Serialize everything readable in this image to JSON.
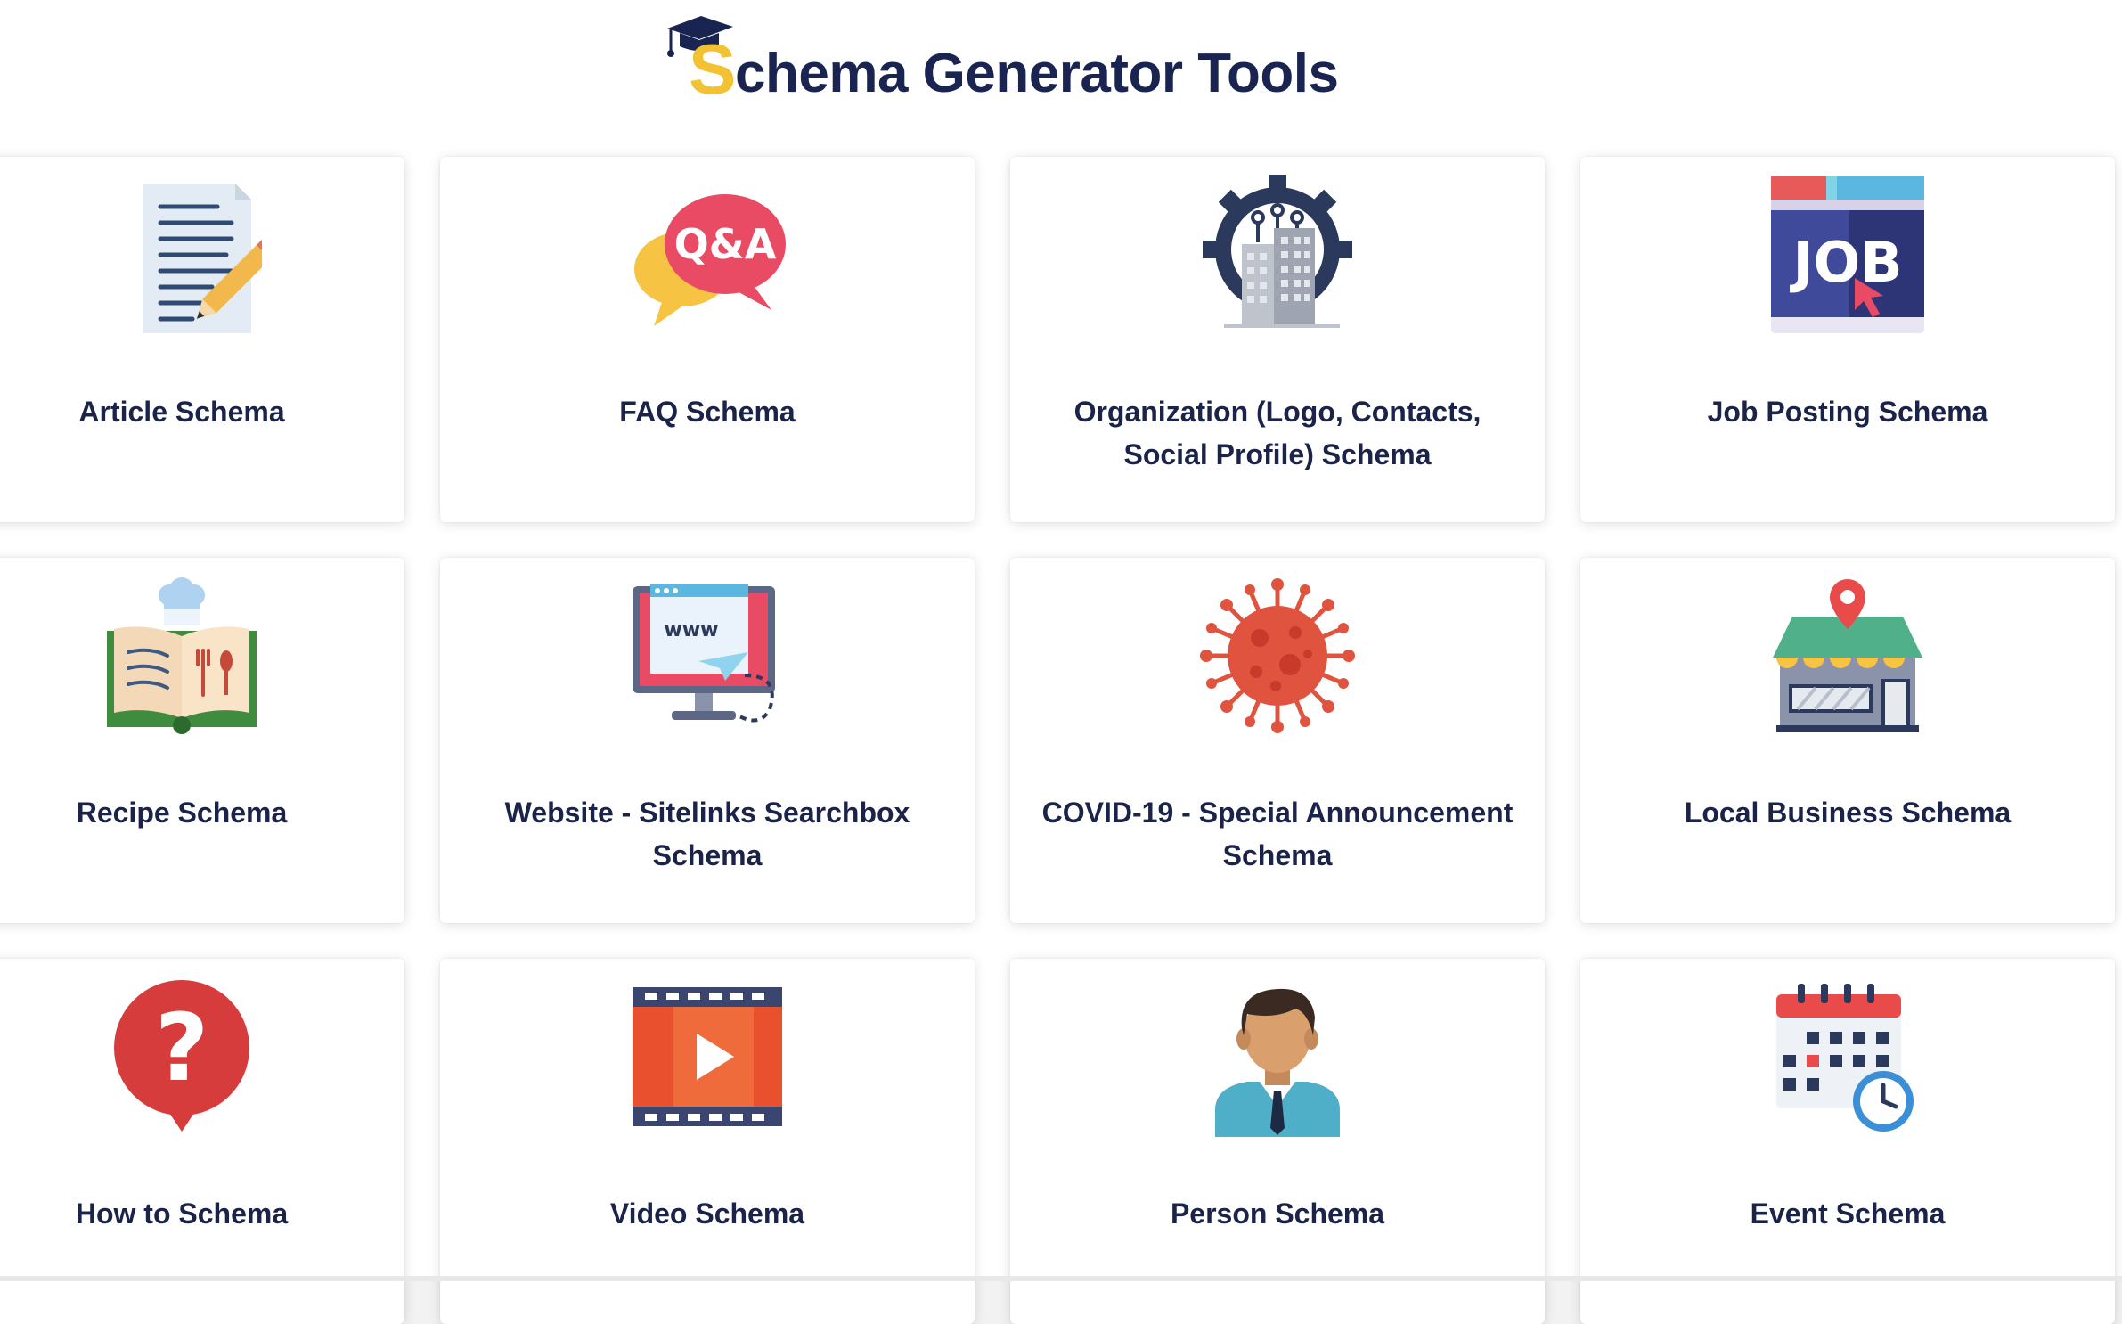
{
  "header": {
    "logo_letter": "S",
    "logo_rest": "chema Generator Tools"
  },
  "colors": {
    "brand_navy": "#1a2451",
    "brand_yellow": "#f2c232",
    "label": "#1b2348"
  },
  "cards": [
    {
      "label": "Article Schema",
      "icon": "article-document-pencil-icon"
    },
    {
      "label": "FAQ Schema",
      "icon": "qa-speech-bubbles-icon"
    },
    {
      "label": "Organization (Logo, Contacts, Social Profile) Schema",
      "icon": "organization-gear-building-icon"
    },
    {
      "label": "Job Posting Schema",
      "icon": "job-browser-icon"
    },
    {
      "label": "Recipe Schema",
      "icon": "recipe-book-chef-hat-icon"
    },
    {
      "label": "Website - Sitelinks Searchbox Schema",
      "icon": "website-monitor-www-icon"
    },
    {
      "label": "COVID-19 - Special Announcement Schema",
      "icon": "virus-icon"
    },
    {
      "label": "Local Business Schema",
      "icon": "storefront-location-pin-icon"
    },
    {
      "label": "How to Schema",
      "icon": "question-mark-bubble-icon"
    },
    {
      "label": "Video Schema",
      "icon": "video-film-play-icon"
    },
    {
      "label": "Person Schema",
      "icon": "person-avatar-icon"
    },
    {
      "label": "Event Schema",
      "icon": "event-calendar-clock-icon"
    }
  ]
}
